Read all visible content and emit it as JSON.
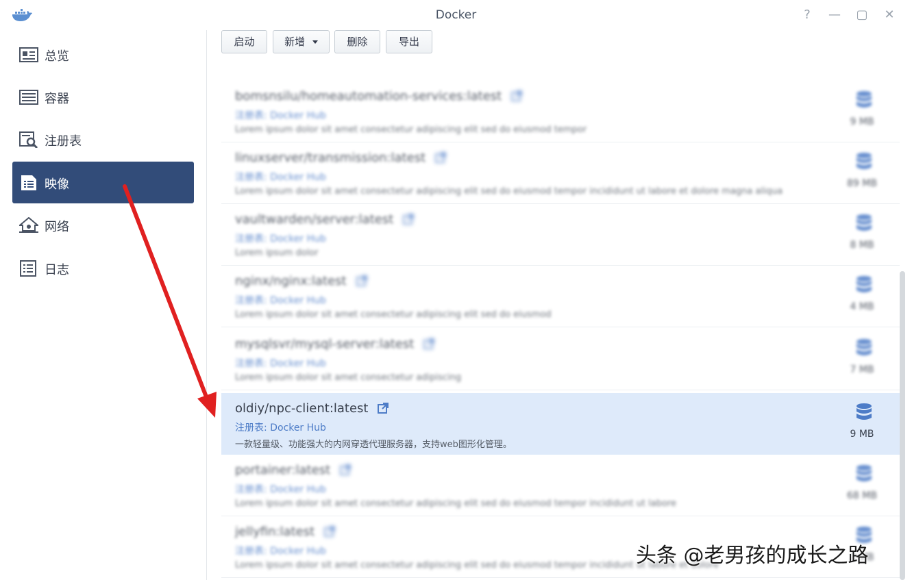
{
  "window": {
    "title": "Docker"
  },
  "window_controls": {
    "help": "?",
    "minimize": "—",
    "maximize": "▢",
    "close": "✕"
  },
  "sidebar": {
    "items": [
      {
        "label": "总览",
        "icon": "overview-icon"
      },
      {
        "label": "容器",
        "icon": "container-icon"
      },
      {
        "label": "注册表",
        "icon": "registry-icon"
      },
      {
        "label": "映像",
        "icon": "image-icon",
        "active": true
      },
      {
        "label": "网络",
        "icon": "network-icon"
      },
      {
        "label": "日志",
        "icon": "log-icon"
      }
    ]
  },
  "toolbar": {
    "launch_label": "启动",
    "add_label": "新增",
    "delete_label": "删除",
    "export_label": "导出"
  },
  "images": [
    {
      "name": "bomsnsilu/homeautomation-services:latest",
      "registry": "注册表: Docker Hub",
      "description": "Lorem ipsum dolor sit amet consectetur adipiscing elit sed do eiusmod tempor",
      "size": "9 MB"
    },
    {
      "name": "linuxserver/transmission:latest",
      "registry": "注册表: Docker Hub",
      "description": "Lorem ipsum dolor sit amet consectetur adipiscing elit sed do eiusmod tempor incididunt ut labore et dolore magna aliqua",
      "size": "89 MB"
    },
    {
      "name": "vaultwarden/server:latest",
      "registry": "注册表: Docker Hub",
      "description": "Lorem ipsum dolor",
      "size": "8 MB"
    },
    {
      "name": "nginx/nginx:latest",
      "registry": "注册表: Docker Hub",
      "description": "Lorem ipsum dolor sit amet consectetur adipiscing elit sed do eiusmod",
      "size": "4 MB"
    },
    {
      "name": "mysqlsvr/mysql-server:latest",
      "registry": "注册表: Docker Hub",
      "description": "Lorem ipsum dolor sit amet consectetur adipiscing",
      "size": "7 MB"
    },
    {
      "name": "oldiy/npc-client:latest",
      "registry": "注册表: Docker Hub",
      "description": "一款轻量级、功能强大的内网穿透代理服务器，支持web图形化管理。",
      "size": "9 MB",
      "selected": true
    },
    {
      "name": "portainer:latest",
      "registry": "注册表: Docker Hub",
      "description": "Lorem ipsum dolor sit amet consectetur adipiscing elit sed do eiusmod tempor incididunt ut labore",
      "size": "68 MB"
    },
    {
      "name": "jellyfin:latest",
      "registry": "注册表: Docker Hub",
      "description": "Lorem ipsum dolor sit amet consectetur adipiscing elit sed do eiusmod tempor incididunt ut labore et dolore",
      "size": "2 MB"
    }
  ],
  "watermark": "头条 @老男孩的成长之路",
  "colors": {
    "accent": "#324c79",
    "selected_row": "#deeafa",
    "arrow": "#e02020",
    "link": "#4d7cc7"
  }
}
